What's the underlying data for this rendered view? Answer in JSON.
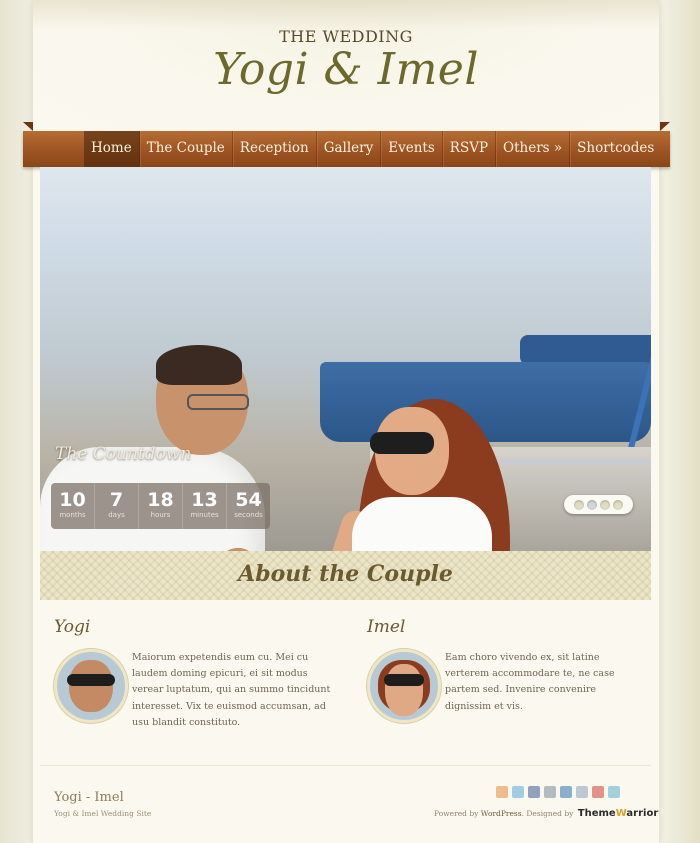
{
  "header": {
    "kicker": "THE WEDDING",
    "title": "Yogi & Imel"
  },
  "nav": {
    "items": [
      {
        "label": "Home",
        "active": true
      },
      {
        "label": "The Couple"
      },
      {
        "label": "Reception"
      },
      {
        "label": "Gallery"
      },
      {
        "label": "Events"
      },
      {
        "label": "RSVP"
      },
      {
        "label": "Others »"
      },
      {
        "label": "Shortcodes"
      }
    ]
  },
  "countdown": {
    "title": "The Countdown",
    "units": [
      {
        "value": "10",
        "label": "months"
      },
      {
        "value": "7",
        "label": "days"
      },
      {
        "value": "18",
        "label": "hours"
      },
      {
        "value": "13",
        "label": "minutes"
      },
      {
        "value": "54",
        "label": "seconds"
      }
    ]
  },
  "slider": {
    "slides": 4,
    "active_index": 1
  },
  "about": {
    "title": "About the Couple",
    "groom": {
      "name": "Yogi",
      "bio": "Maiorum expetendis eum cu. Mei cu laudem doming epicuri, ei sit modus verear luptatum, qui an summo tincidunt interesset. Vix te euismod accumsan, ad usu blandit constituto."
    },
    "bride": {
      "name": "Imel",
      "bio": "Eam choro vivendo ex, sit latine verterem accommodare te, ne case partem sed. Invenire convenire dignissim et vis."
    }
  },
  "footer": {
    "site_title": "Yogi - Imel",
    "tagline": "Yogi & Imel Wedding Site",
    "powered_prefix": "Powered by ",
    "wordpress": "WordPress",
    "designed_by": ". Designed by ",
    "brand_a": "Theme",
    "brand_w": "W",
    "brand_b": "arrior",
    "social_icons": [
      "rss-icon",
      "twitter-icon",
      "facebook-icon",
      "flickr-icon",
      "linkedin-icon",
      "myspace-icon",
      "youtube-icon",
      "vimeo-icon"
    ]
  },
  "colors": {
    "nav_brown": "#9e5424",
    "title_olive": "#6b6a2c",
    "page_bg": "#fbf9ef"
  }
}
